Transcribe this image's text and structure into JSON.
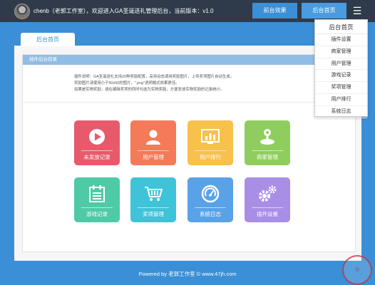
{
  "header": {
    "welcome": "chenb（老郭工作室），欢迎进入GA圣诞送礼管理后台，当前版本：v1.0",
    "front_btn": "前台效果",
    "back_btn": "后台首页",
    "menu_glyph": "☰"
  },
  "dropdown": {
    "title": "后台首页",
    "items": [
      "插件设置",
      "商家管理",
      "用户管理",
      "游戏记录",
      "奖项管理",
      "用户排行",
      "系统日志"
    ]
  },
  "tab": {
    "label": "后台首页"
  },
  "panel": {
    "heading": "插件后台目录",
    "info_lines": [
      "插件说明：GA圣诞送礼支持20种奖励配置，采用动态调用奖励图片，上传奖项图片自动生成。",
      "奖励图片请使用小于50x50的图片，\".png\"透明格式效果更佳。",
      "如果是实物奖励，请在编辑奖项的同时勾选为实物奖励，方便发放实物奖励的记录统计。"
    ]
  },
  "tiles": [
    {
      "label": "未发放记录",
      "color": "#e85a6b",
      "icon": "play-icon"
    },
    {
      "label": "用户管理",
      "color": "#f47a5a",
      "icon": "user-icon"
    },
    {
      "label": "用户排行",
      "color": "#f7c14c",
      "icon": "chart-icon"
    },
    {
      "label": "商家管理",
      "color": "#8fce5e",
      "icon": "joystick-icon"
    },
    {
      "label": "游戏记录",
      "color": "#4fcaa6",
      "icon": "calendar-icon"
    },
    {
      "label": "奖项管理",
      "color": "#3fc3d8",
      "icon": "cart-icon"
    },
    {
      "label": "系统日志",
      "color": "#5aa2e8",
      "icon": "gauge-icon"
    },
    {
      "label": "插件设置",
      "color": "#a98ee6",
      "icon": "gears-icon"
    }
  ],
  "footer": {
    "text": "Powered by 老郭工作室 © www.47jh.com"
  }
}
